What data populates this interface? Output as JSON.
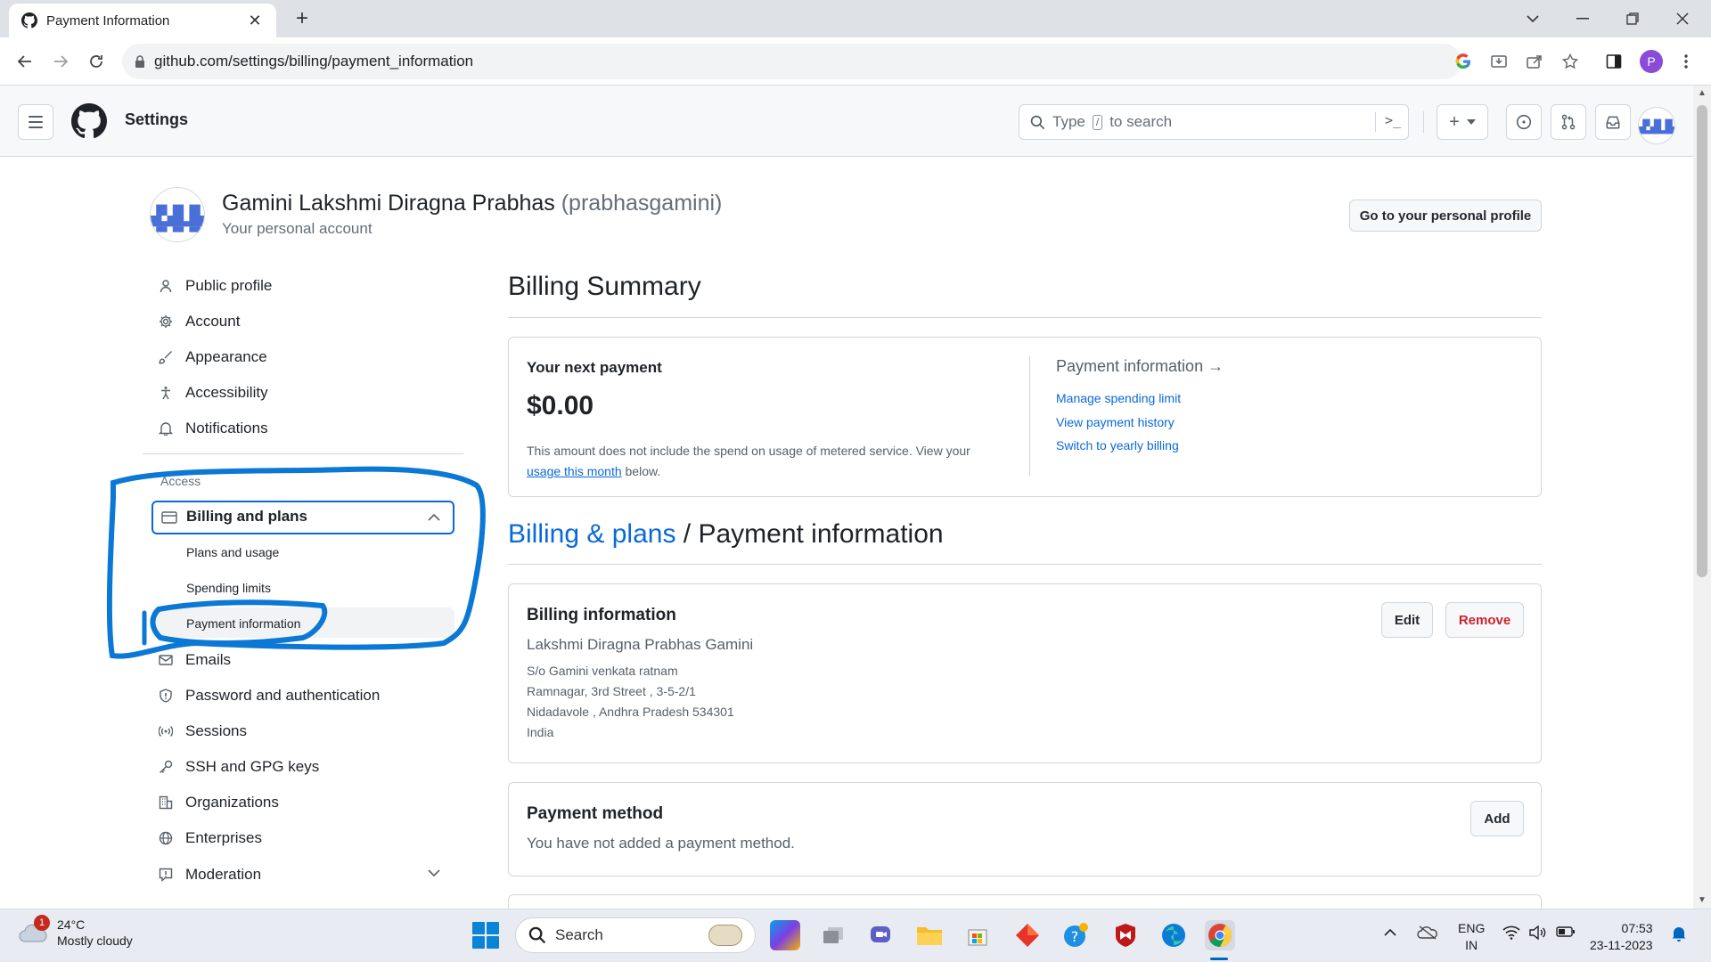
{
  "browser": {
    "tab_title": "Payment Information",
    "url": "github.com/settings/billing/payment_information",
    "profile_initial": "P"
  },
  "header": {
    "context": "Settings",
    "search_prefix": "Type",
    "search_key": "/",
    "search_suffix": "to search",
    "plus_label": "+"
  },
  "account": {
    "name": "Gamini Lakshmi Diragna Prabhas",
    "login": "(prabhasgamini)",
    "subtitle": "Your personal account",
    "profile_button": "Go to your personal profile"
  },
  "sidebar": {
    "items_top": [
      {
        "label": "Public profile",
        "icon": "person-icon"
      },
      {
        "label": "Account",
        "icon": "gear-icon"
      },
      {
        "label": "Appearance",
        "icon": "paintbrush-icon"
      },
      {
        "label": "Accessibility",
        "icon": "accessibility-icon"
      },
      {
        "label": "Notifications",
        "icon": "bell-icon"
      }
    ],
    "access_heading": "Access",
    "billing": {
      "label": "Billing and plans",
      "children": [
        "Plans and usage",
        "Spending limits",
        "Payment information"
      ]
    },
    "items_bottom": [
      {
        "label": "Emails",
        "icon": "mail-icon"
      },
      {
        "label": "Password and authentication",
        "icon": "shield-icon"
      },
      {
        "label": "Sessions",
        "icon": "broadcast-icon"
      },
      {
        "label": "SSH and GPG keys",
        "icon": "key-icon"
      },
      {
        "label": "Organizations",
        "icon": "organization-icon"
      },
      {
        "label": "Enterprises",
        "icon": "globe-icon"
      },
      {
        "label": "Moderation",
        "icon": "report-icon"
      }
    ]
  },
  "billing_summary": {
    "title": "Billing Summary",
    "next_payment_label": "Your next payment",
    "amount": "$0.00",
    "note_before": "This amount does not include the spend on usage of metered service. View your",
    "note_link": "usage this month",
    "note_after": "below.",
    "payment_info_heading": "Payment information →",
    "links": [
      "Manage spending limit",
      "View payment history",
      "Switch to yearly billing"
    ]
  },
  "page_heading": {
    "crumb": "Billing & plans",
    "separator": " / ",
    "current": "Payment information"
  },
  "billing_info": {
    "title": "Billing information",
    "name": "Lakshmi Diragna Prabhas Gamini",
    "address": [
      "S/o Gamini venkata ratnam",
      "Ramnagar, 3rd Street , 3-5-2/1",
      "Nidadavole , Andhra Pradesh 534301",
      "India"
    ],
    "edit_label": "Edit",
    "remove_label": "Remove"
  },
  "payment_method": {
    "title": "Payment method",
    "empty_text": "You have not added a payment method.",
    "add_label": "Add"
  },
  "taskbar": {
    "weather_badge": "1",
    "weather_temp": "24°C",
    "weather_desc": "Mostly cloudy",
    "search_label": "Search",
    "lang_top": "ENG",
    "lang_bottom": "IN",
    "time": "07:53",
    "date": "23-11-2023"
  },
  "colors": {
    "accent": "#0969da",
    "annotation": "#0a78d4",
    "danger": "#cf222e"
  }
}
